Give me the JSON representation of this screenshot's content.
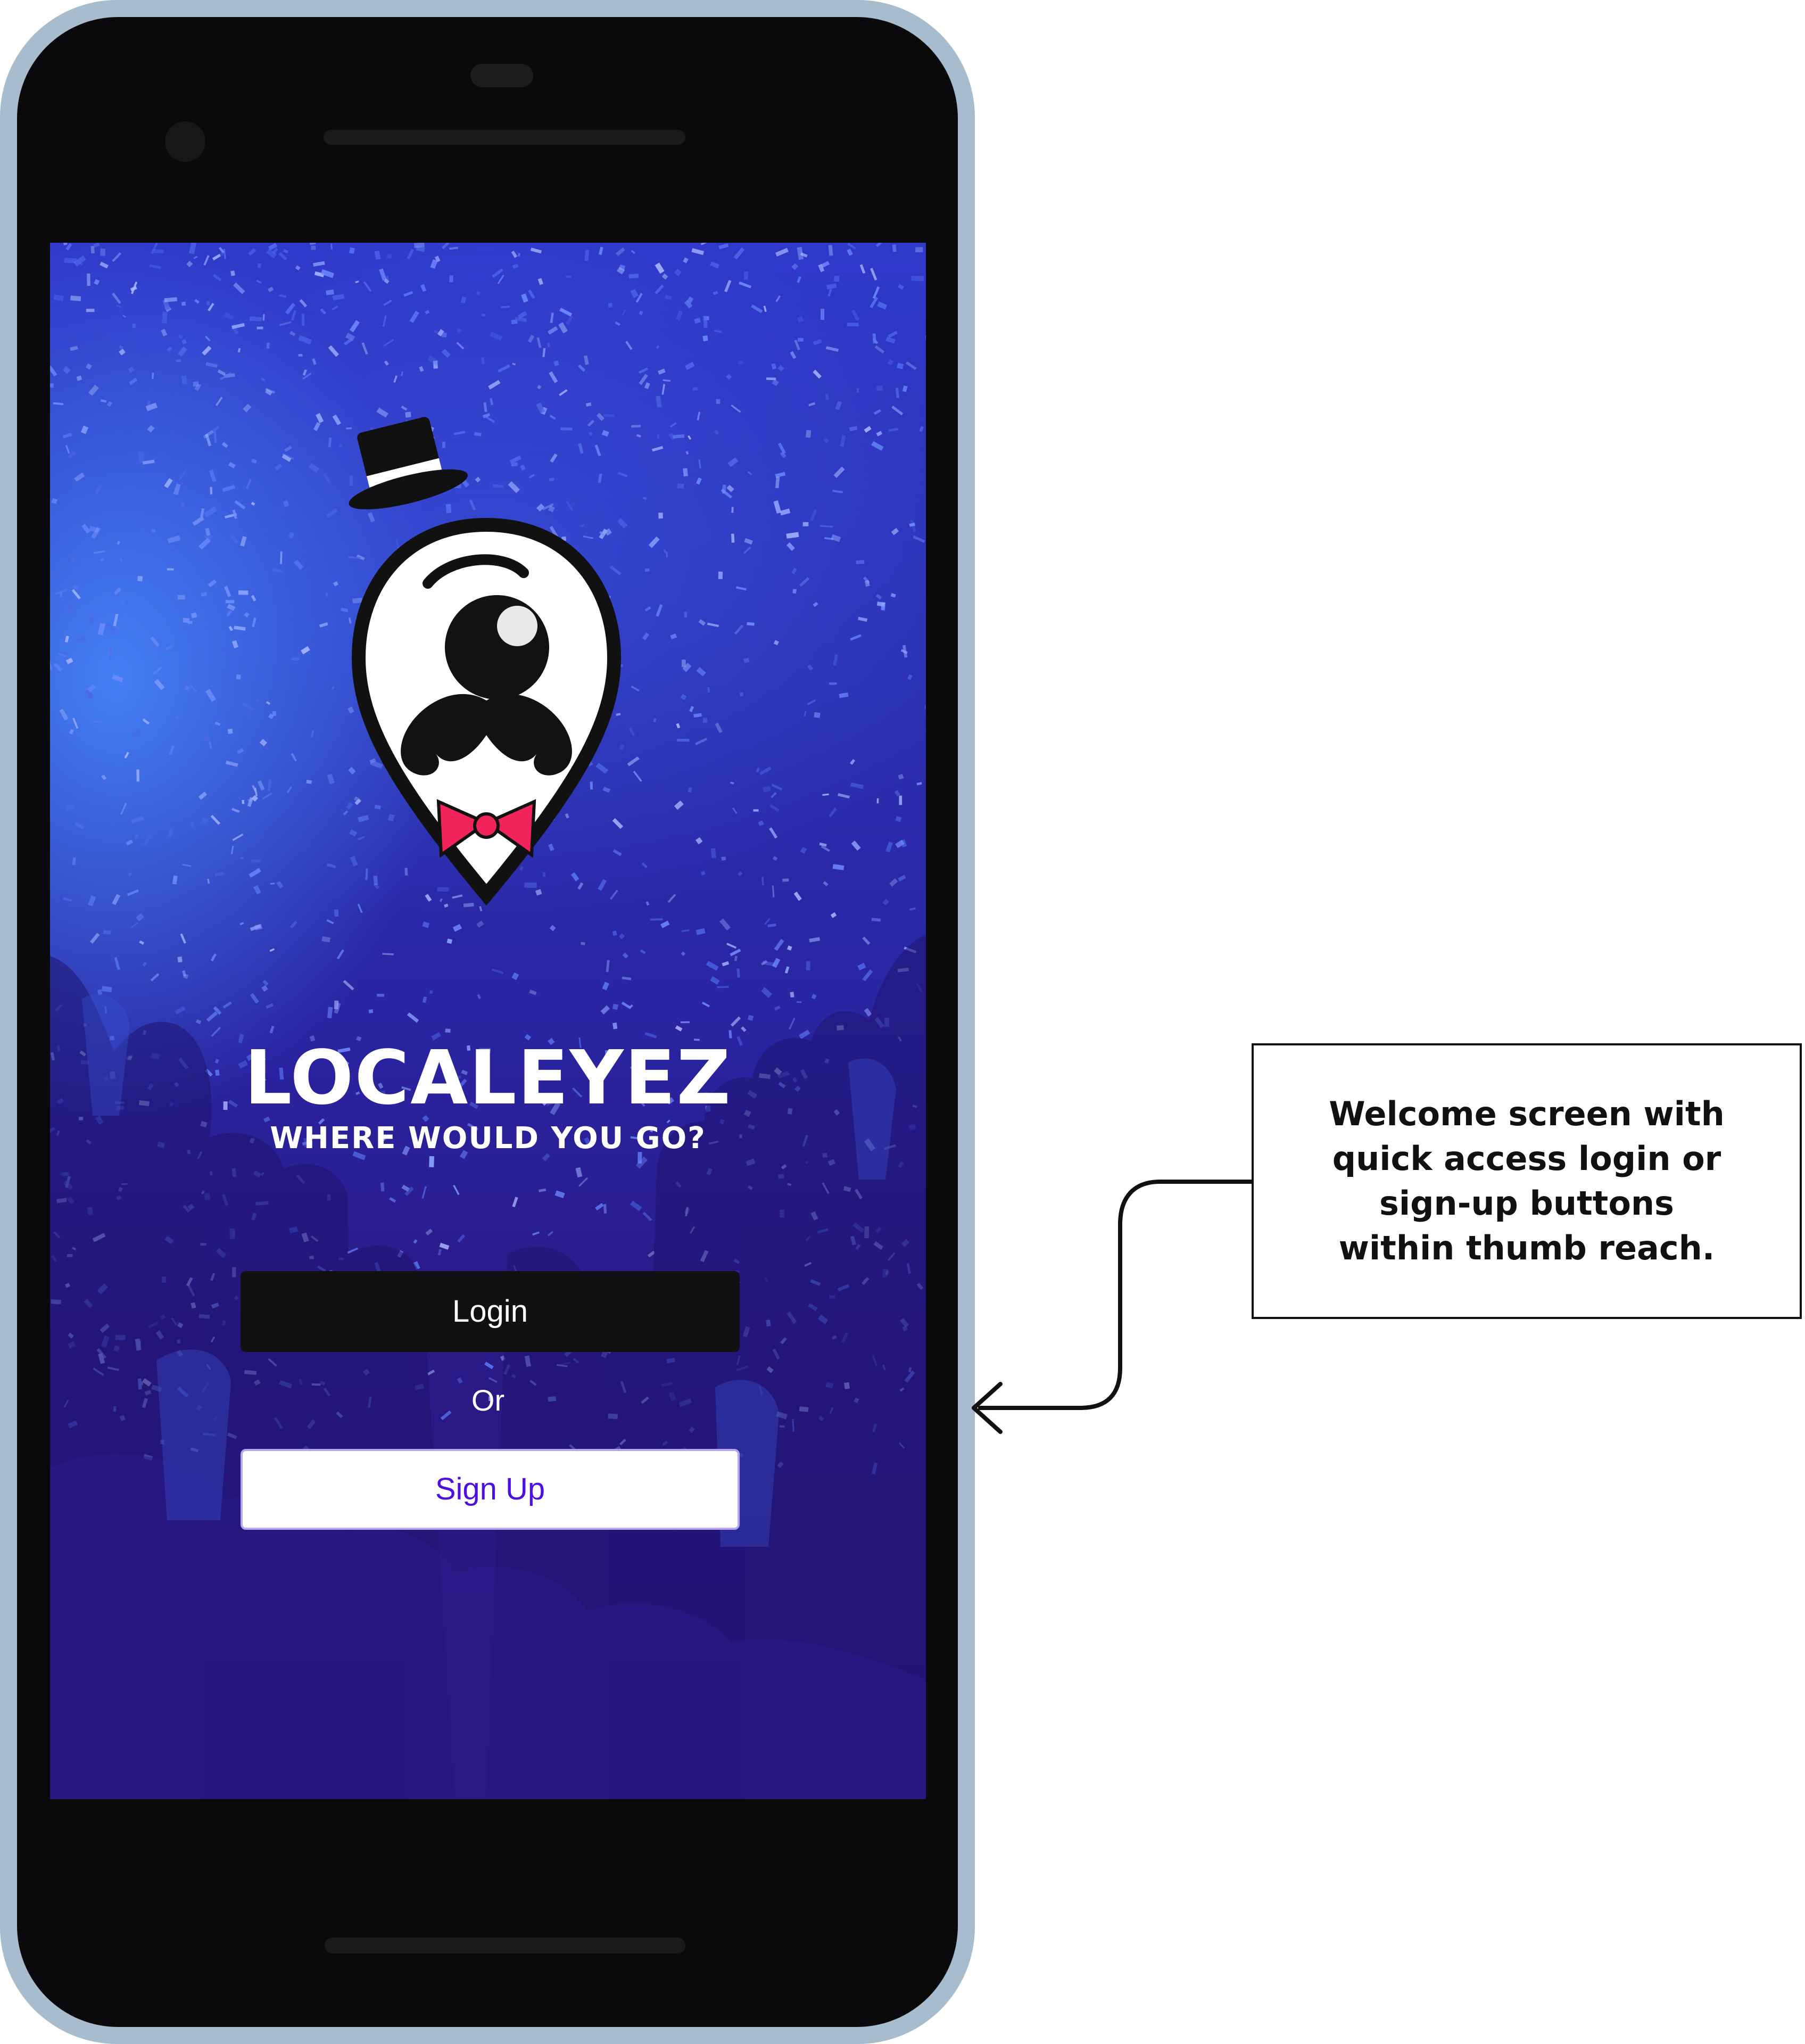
{
  "app": {
    "brand_name": "LOCALEYEZ",
    "tagline": "WHERE WOULD YOU GO?"
  },
  "actions": {
    "login_label": "Login",
    "separator_label": "Or",
    "signup_label": "Sign Up"
  },
  "annotation": {
    "text": "Welcome screen with quick access login or sign-up buttons within thumb reach."
  },
  "colors": {
    "phone_frame": "#a7bccd",
    "phone_body": "#0a0a0c",
    "login_button": "#111114",
    "signup_text": "#4c10e0",
    "bow_tie": "#f0245a",
    "screen_top": "#2f39c9",
    "screen_bottom": "#2a167a"
  },
  "icons": {
    "logo": "mascot-pin-icon",
    "hat": "top-hat-icon",
    "bow": "bow-tie-icon",
    "arrow": "arrow-left-icon"
  }
}
